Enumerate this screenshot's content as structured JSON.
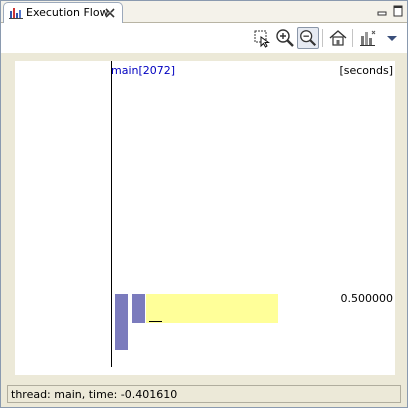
{
  "tab": {
    "title": "Execution Flow",
    "icon": "execution-flow-icon",
    "close_icon": "close-icon"
  },
  "window_controls": {
    "minimize_icon": "minimize-icon",
    "maximize_icon": "maximize-icon"
  },
  "toolbar": {
    "buttons": [
      {
        "icon": "select-zoom-icon",
        "pressed": false
      },
      {
        "icon": "zoom-in-icon",
        "pressed": false
      },
      {
        "icon": "zoom-out-icon",
        "pressed": true
      },
      {
        "icon": "home-icon",
        "pressed": false
      },
      {
        "icon": "chart-options-icon",
        "pressed": false
      },
      {
        "icon": "view-menu-icon",
        "pressed": false
      }
    ]
  },
  "canvas": {
    "thread_label": "main[2072]",
    "units_label": "[seconds]",
    "tick_label": "0.500000"
  },
  "status": {
    "text": "thread: main, time: -0.401610"
  },
  "colors": {
    "thread_text": "#0000c0",
    "method_bar": "#7b7bbd",
    "selected_bar": "#ffff99"
  }
}
